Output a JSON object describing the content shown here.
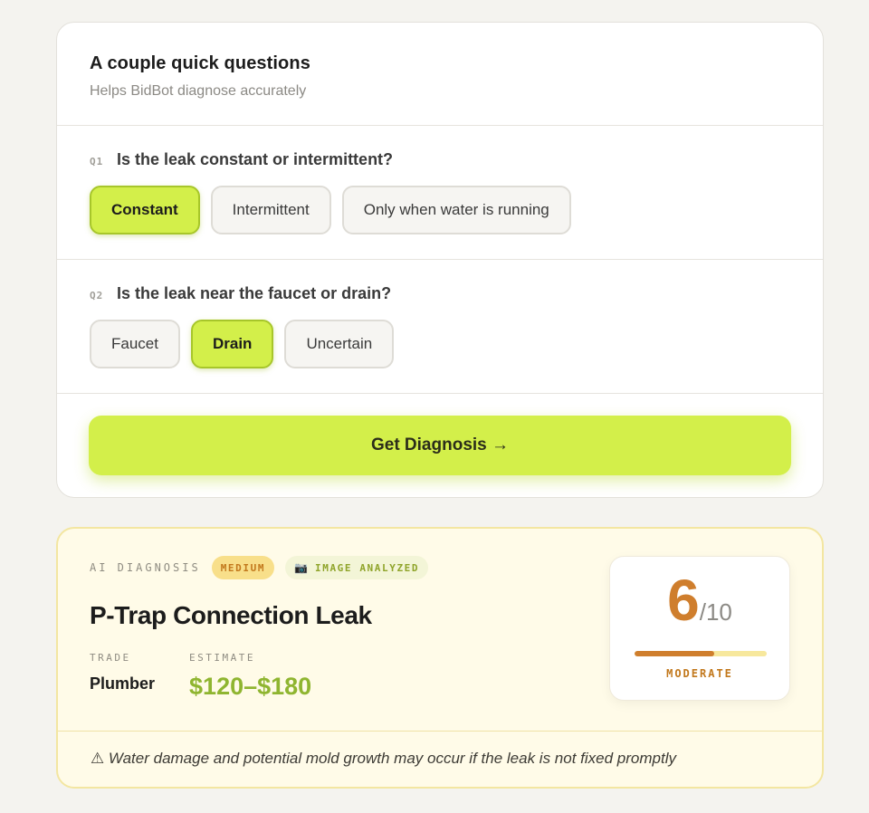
{
  "questions_card": {
    "title": "A couple quick questions",
    "subtitle": "Helps BidBot diagnose accurately",
    "questions": [
      {
        "num": "Q1",
        "text": "Is the leak constant or intermittent?",
        "options": [
          "Constant",
          "Intermittent",
          "Only when water is running"
        ],
        "selected": "Constant"
      },
      {
        "num": "Q2",
        "text": "Is the leak near the faucet or drain?",
        "options": [
          "Faucet",
          "Drain",
          "Uncertain"
        ],
        "selected": "Drain"
      }
    ],
    "cta_label": "Get Diagnosis →"
  },
  "diagnosis": {
    "label": "AI DIAGNOSIS",
    "severity_badge": "MEDIUM",
    "image_badge": "IMAGE ANALYZED",
    "image_badge_icon": "camera-icon",
    "title": "P-Trap Connection Leak",
    "trade_label": "TRADE",
    "trade_value": "Plumber",
    "estimate_label": "ESTIMATE",
    "estimate_value": "$120–$180",
    "score": "6",
    "score_max": "/10",
    "score_fraction": 0.6,
    "score_label": "MODERATE",
    "warning_icon": "warning-icon",
    "warning": "Water damage and potential mold growth may occur if the leak is not fixed promptly"
  },
  "colors": {
    "accent": "#d3ef4a",
    "accent_border": "#a7c62a",
    "score_orange": "#cf7e2d",
    "price_green": "#8fb530",
    "diag_bg": "#fffbe8"
  }
}
